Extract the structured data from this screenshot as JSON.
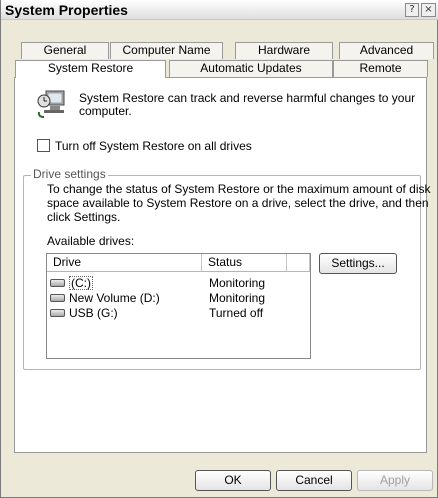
{
  "window": {
    "title": "System Properties",
    "help_glyph": "?",
    "close_glyph": "×"
  },
  "tabs_back": [
    "General",
    "Computer Name",
    "Hardware",
    "Advanced"
  ],
  "tabs_front": [
    "System Restore",
    "Automatic Updates",
    "Remote"
  ],
  "active_tab": "System Restore",
  "intro": {
    "icon": "system-restore-icon",
    "text_line1": "System Restore can track and reverse harmful changes to your",
    "text_line2": "computer."
  },
  "turn_off": {
    "label": "Turn off System Restore on all drives",
    "checked": false
  },
  "drive_settings": {
    "title": "Drive settings",
    "desc_line1": "To change the status of System Restore or the maximum amount of disk",
    "desc_line2": "space available to System Restore on a drive, select the drive, and then",
    "desc_line3": "click Settings.",
    "available_label": "Available drives:",
    "columns": [
      "Drive",
      "Status"
    ],
    "drives": [
      {
        "name": "(C:)",
        "status": "Monitoring",
        "icon": "drive-icon"
      },
      {
        "name": "New Volume (D:)",
        "status": "Monitoring",
        "icon": "drive-icon"
      },
      {
        "name": "USB (G:)",
        "status": "Turned off",
        "icon": "drive-icon"
      }
    ],
    "settings_button": "Settings..."
  },
  "footer": {
    "ok": "OK",
    "cancel": "Cancel",
    "apply": "Apply"
  }
}
